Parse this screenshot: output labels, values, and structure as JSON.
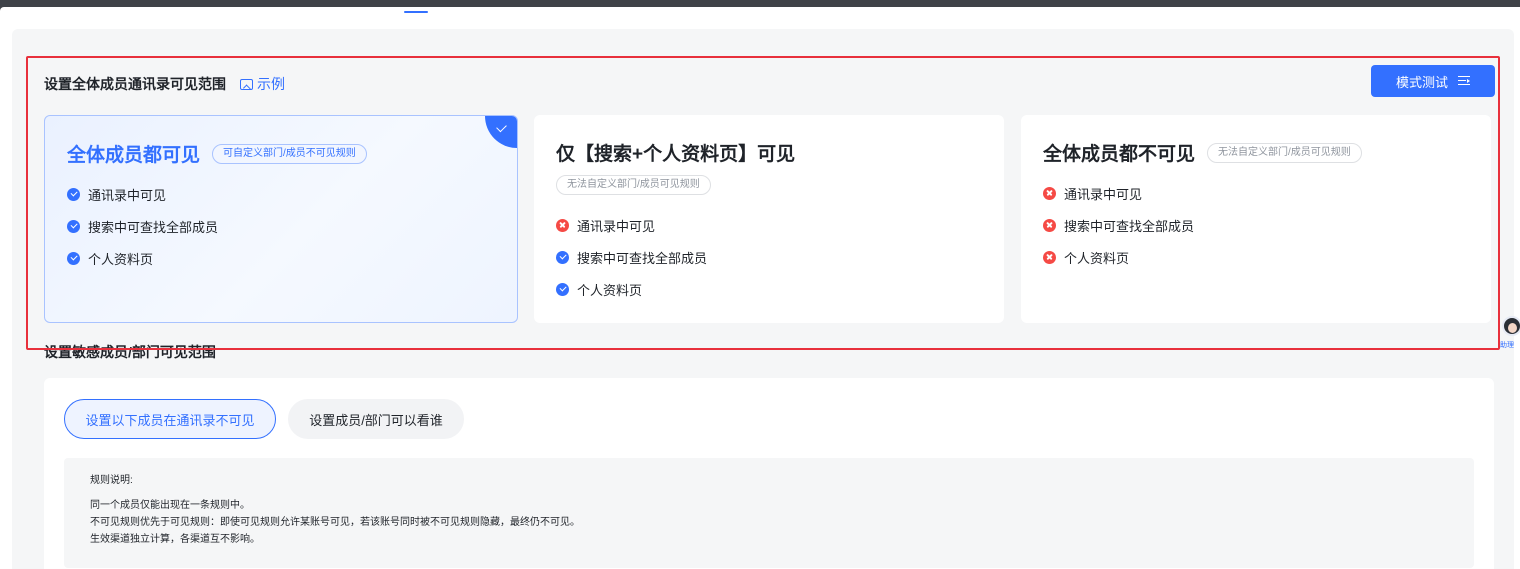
{
  "visibility_section": {
    "title": "设置全体成员通讯录可见范围",
    "example_link": "示例",
    "mode_test_button": "模式测试",
    "cards": [
      {
        "title": "全体成员都可见",
        "tag": "可自定义部门/成员不可见规则",
        "selected": true,
        "features": [
          {
            "label": "通讯录中可见",
            "status": "check"
          },
          {
            "label": "搜索中可查找全部成员",
            "status": "check"
          },
          {
            "label": "个人资料页",
            "status": "check"
          }
        ]
      },
      {
        "title": "仅【搜索+个人资料页】可见",
        "tag": "无法自定义部门/成员可见规则",
        "selected": false,
        "features": [
          {
            "label": "通讯录中可见",
            "status": "cross"
          },
          {
            "label": "搜索中可查找全部成员",
            "status": "check"
          },
          {
            "label": "个人资料页",
            "status": "check"
          }
        ]
      },
      {
        "title": "全体成员都不可见",
        "tag": "无法自定义部门/成员可见规则",
        "selected": false,
        "features": [
          {
            "label": "通讯录中可见",
            "status": "cross"
          },
          {
            "label": "搜索中可查找全部成员",
            "status": "cross"
          },
          {
            "label": "个人资料页",
            "status": "cross"
          }
        ]
      }
    ]
  },
  "sensitive_section": {
    "title": "设置敏感成员/部门可见范围",
    "tabs": [
      {
        "label": "设置以下成员在通讯录不可见",
        "active": true
      },
      {
        "label": "设置成员/部门可以看谁",
        "active": false
      }
    ],
    "rules": {
      "title": "规则说明:",
      "lines": [
        "同一个成员仅能出现在一条规则中。",
        "不可见规则优先于可见规则：即使可见规则允许某账号可见，若该账号同时被不可见规则隐藏，最终仍不可见。",
        "生效渠道独立计算，各渠道互不影响。"
      ]
    }
  },
  "assistant": {
    "label": "助理"
  },
  "colors": {
    "accent": "#3370ff",
    "error": "#f54a45",
    "highlight": "#e8303c"
  }
}
